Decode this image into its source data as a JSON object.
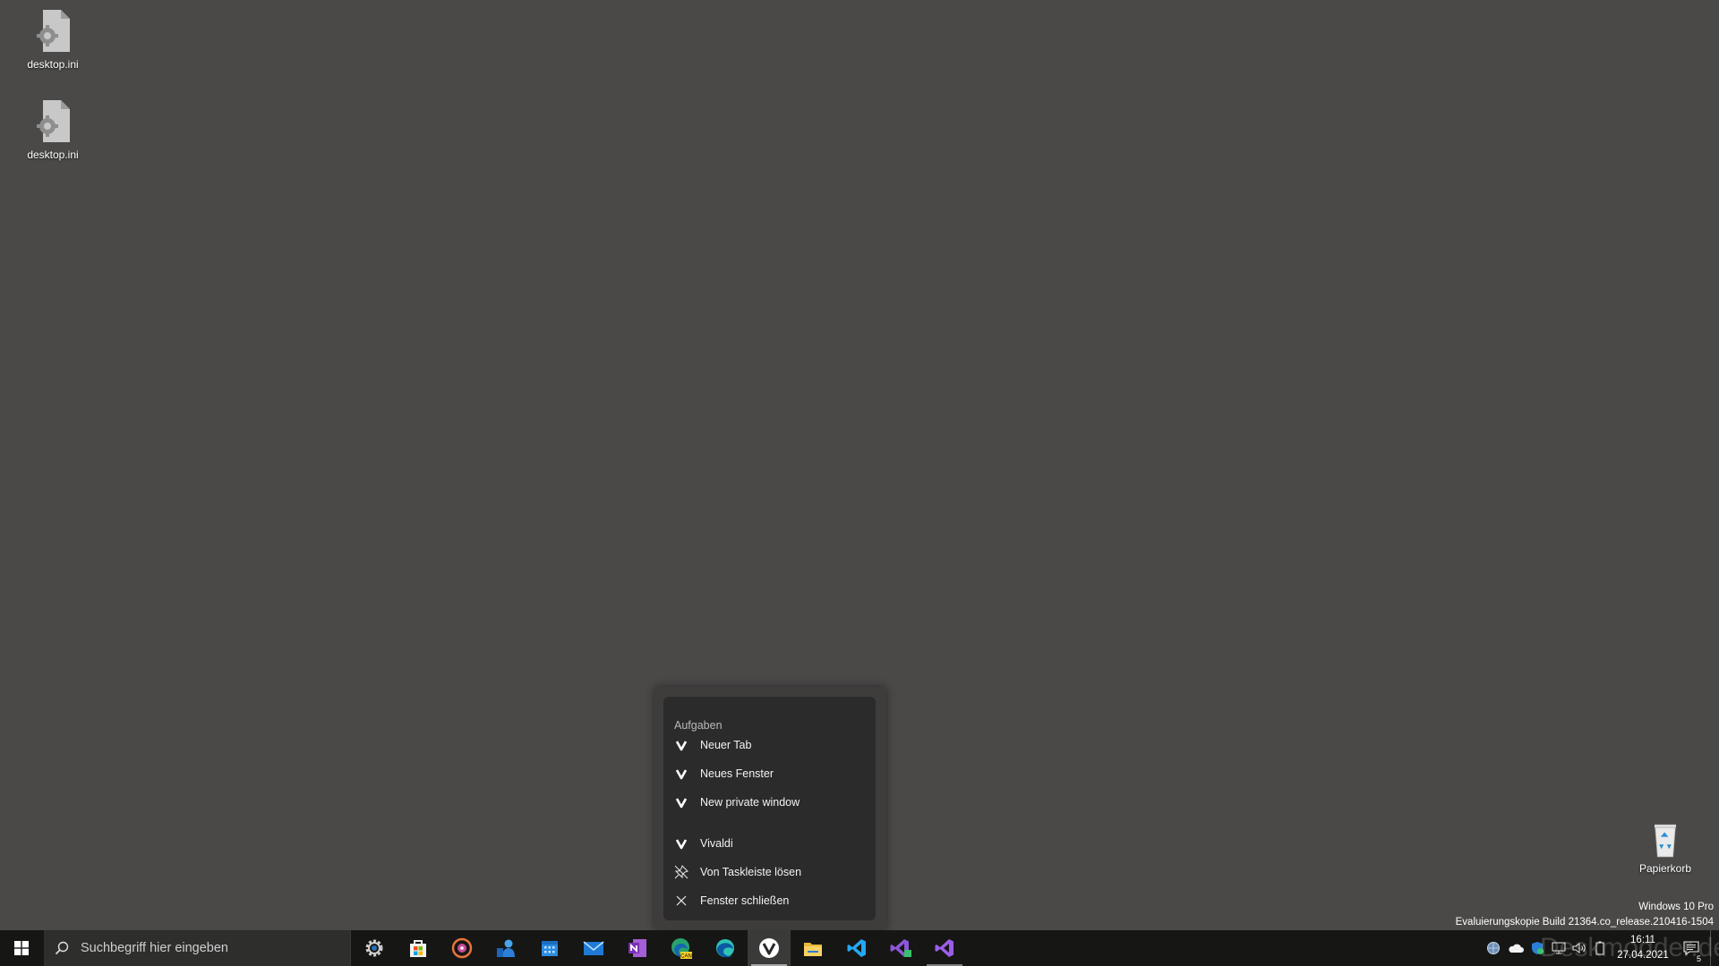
{
  "desktop": {
    "icons": [
      {
        "label": "desktop.ini"
      },
      {
        "label": "desktop.ini"
      },
      {
        "label": "Papierkorb"
      }
    ]
  },
  "jumplist": {
    "heading": "Aufgaben",
    "items": [
      {
        "label": "Neuer Tab",
        "icon": "vivaldi-icon"
      },
      {
        "label": "Neues Fenster",
        "icon": "vivaldi-icon"
      },
      {
        "label": "New private window",
        "icon": "vivaldi-icon"
      },
      {
        "label": "Vivaldi",
        "icon": "vivaldi-icon"
      },
      {
        "label": "Von Taskleiste lösen",
        "icon": "unpin-icon"
      },
      {
        "label": "Fenster schließen",
        "icon": "close-icon"
      }
    ]
  },
  "taskbar": {
    "search_placeholder": "Suchbegriff hier eingeben",
    "apps": [
      "settings-icon",
      "store-icon",
      "groove-music-icon",
      "people-icon",
      "calendar-icon",
      "mail-icon",
      "onenote-icon",
      "edge-canary-icon",
      "edge-icon",
      "vivaldi-icon",
      "file-explorer-icon",
      "vscode-icon",
      "visual-studio-preview-icon",
      "visual-studio-icon"
    ],
    "active_app": "vivaldi-icon",
    "clock_time": "16:11",
    "clock_date": "27.04.2021",
    "notification_count": "5"
  },
  "watermark": {
    "edition": "Windows 10 Pro",
    "build": "Evaluierungskopie Build 21364.co_release.210416-1504"
  },
  "overlay": {
    "site": "Deskmodder.de"
  },
  "colors": {
    "desktop_bg": "#4a4948",
    "taskbar_bg": "#161615",
    "vivaldi_red": "#ef3939"
  }
}
